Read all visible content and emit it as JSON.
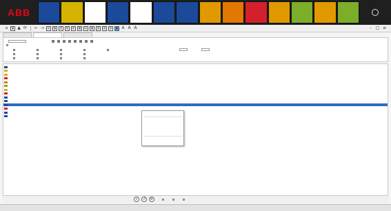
{
  "brand": {
    "logo_text": "ABB",
    "accent": "#e30613"
  },
  "status_tiles": [
    {
      "label": "",
      "sub": "",
      "color": "#1b4a9a"
    },
    {
      "label": "",
      "sub": "",
      "color": "#d4b400"
    },
    {
      "label": "",
      "sub": "",
      "color": "#ffffff"
    },
    {
      "label": "",
      "sub": "",
      "color": "#1b4a9a"
    },
    {
      "label": "",
      "sub": "",
      "color": "#ffffff"
    },
    {
      "label": "",
      "sub": "",
      "color": "#1b4a9a"
    },
    {
      "label": "",
      "sub": "",
      "color": "#1b4a9a"
    },
    {
      "label": "",
      "sub": "",
      "color": "#e09a00"
    },
    {
      "label": "",
      "sub": "",
      "color": "#e27800"
    },
    {
      "label": "",
      "sub": "",
      "color": "#d4202c"
    },
    {
      "label": "",
      "sub": "",
      "color": "#e09a00"
    },
    {
      "label": "",
      "sub": "",
      "color": "#7cae2a"
    },
    {
      "label": "",
      "sub": "",
      "color": "#e09a00"
    },
    {
      "label": "",
      "sub": "",
      "color": "#7cae2a"
    }
  ],
  "tabs": [
    {
      "label": ""
    },
    {
      "label": ""
    },
    {
      "label": ""
    }
  ],
  "filters": {
    "time_label": "",
    "time_value": "",
    "priority_label": "",
    "options_row1": [
      "",
      "",
      "",
      "",
      ""
    ],
    "options_row2": [
      "",
      "",
      "",
      ""
    ],
    "options_row3": [
      "",
      "",
      "",
      ""
    ]
  },
  "events": [
    {
      "time": "",
      "src": "",
      "obj": "",
      "desc": "",
      "sev_color": "#1b4a9a"
    },
    {
      "time": "",
      "src": "",
      "obj": "",
      "desc": "",
      "sev_color": "#d4b400"
    },
    {
      "time": "",
      "src": "",
      "obj": "",
      "desc": "",
      "sev_color": "#d4b400"
    },
    {
      "time": "",
      "src": "",
      "obj": "",
      "desc": "",
      "sev_color": "#d4202c"
    },
    {
      "time": "",
      "src": "",
      "obj": "",
      "desc": "",
      "sev_color": "#e27800"
    },
    {
      "time": "",
      "src": "",
      "obj": "",
      "desc": "",
      "sev_color": "#7cae2a"
    },
    {
      "time": "",
      "src": "",
      "obj": "",
      "desc": "",
      "sev_color": "#d4b400"
    },
    {
      "time": "",
      "src": "",
      "obj": "",
      "desc": "",
      "sev_color": "#d4202c"
    },
    {
      "time": "",
      "src": "",
      "obj": "",
      "desc": "",
      "sev_color": "#1b4a9a"
    },
    {
      "time": "",
      "src": "",
      "obj": "",
      "desc": "",
      "sev_color": "#1b4a9a"
    },
    {
      "time": "",
      "src": "",
      "obj": "",
      "desc": "",
      "sev_color": "#1b4a9a",
      "selected": true
    },
    {
      "time": "",
      "src": "",
      "obj": "",
      "desc": "",
      "sev_color": "#d4202c"
    },
    {
      "time": "",
      "src": "",
      "obj": "",
      "desc": "",
      "sev_color": "#1b4a9a"
    },
    {
      "time": "",
      "src": "",
      "obj": "",
      "desc": "",
      "sev_color": "#1b4a9a"
    }
  ],
  "context_menu": {
    "items": [
      "",
      "",
      "",
      "",
      "",
      "",
      ""
    ]
  },
  "bottom": {
    "options": [
      "",
      "",
      ""
    ]
  },
  "footer": {
    "left": "",
    "items": [
      "",
      "",
      "",
      ""
    ]
  }
}
